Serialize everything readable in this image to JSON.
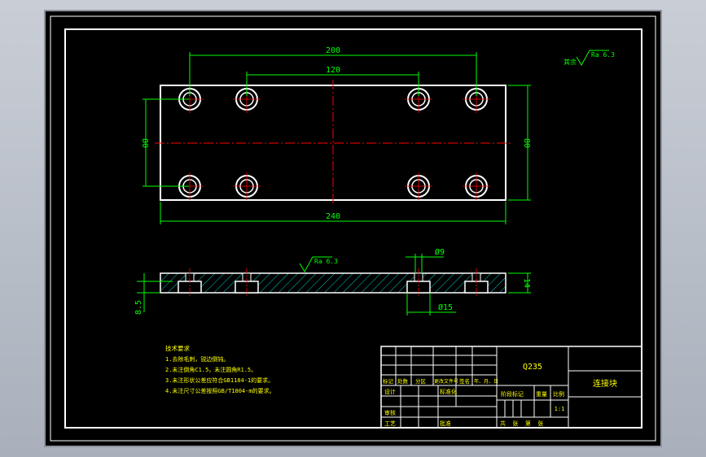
{
  "colors": {
    "background": "#000000",
    "outline": "#ffffff",
    "dimension": "#00ff00",
    "centerline": "#ff0000",
    "hatch": "#00c8c8",
    "note_text": "#ffff00",
    "title_text": "#ffff00",
    "frame_outer": "#c9ced6"
  },
  "top_view": {
    "dim_overall_length": "240",
    "dim_hole_span_outer": "200",
    "dim_hole_span_inner": "120",
    "dim_height_left": "80",
    "dim_height_right": "80"
  },
  "front_view": {
    "dim_thickness": "14",
    "dim_counterbore_depth": "8.5",
    "dim_hole_small": "Ø9",
    "dim_counterbore_dia": "Ø15",
    "surface_finish": "Ra 6.3"
  },
  "corner_roughness": {
    "label": "其余",
    "value": "Ra 6.3"
  },
  "tech_notes": {
    "title": "技术要求",
    "lines": [
      "1.去除毛刺，锐边倒钝。",
      "2.未注倒角C1.5，未注圆角R1.5。",
      "3.未注形状公差应符合GB1184-1的要求。",
      "4.未注尺寸公差按照GB/T1804-m的要求。"
    ]
  },
  "title_block": {
    "material": "Q235",
    "part_name": "连接块",
    "row_labels": [
      "标记",
      "处数",
      "分区",
      "更改文件号",
      "签名",
      "年、月、日"
    ],
    "label_design": "设计",
    "label_standard": "标准化",
    "label_review": "审核",
    "label_process": "工艺",
    "label_approve": "批准",
    "label_stage": "阶段标记",
    "label_weight": "重量",
    "label_scale": "比例",
    "scale_value": "1:1",
    "sheet_text": "共  张  第  张"
  }
}
